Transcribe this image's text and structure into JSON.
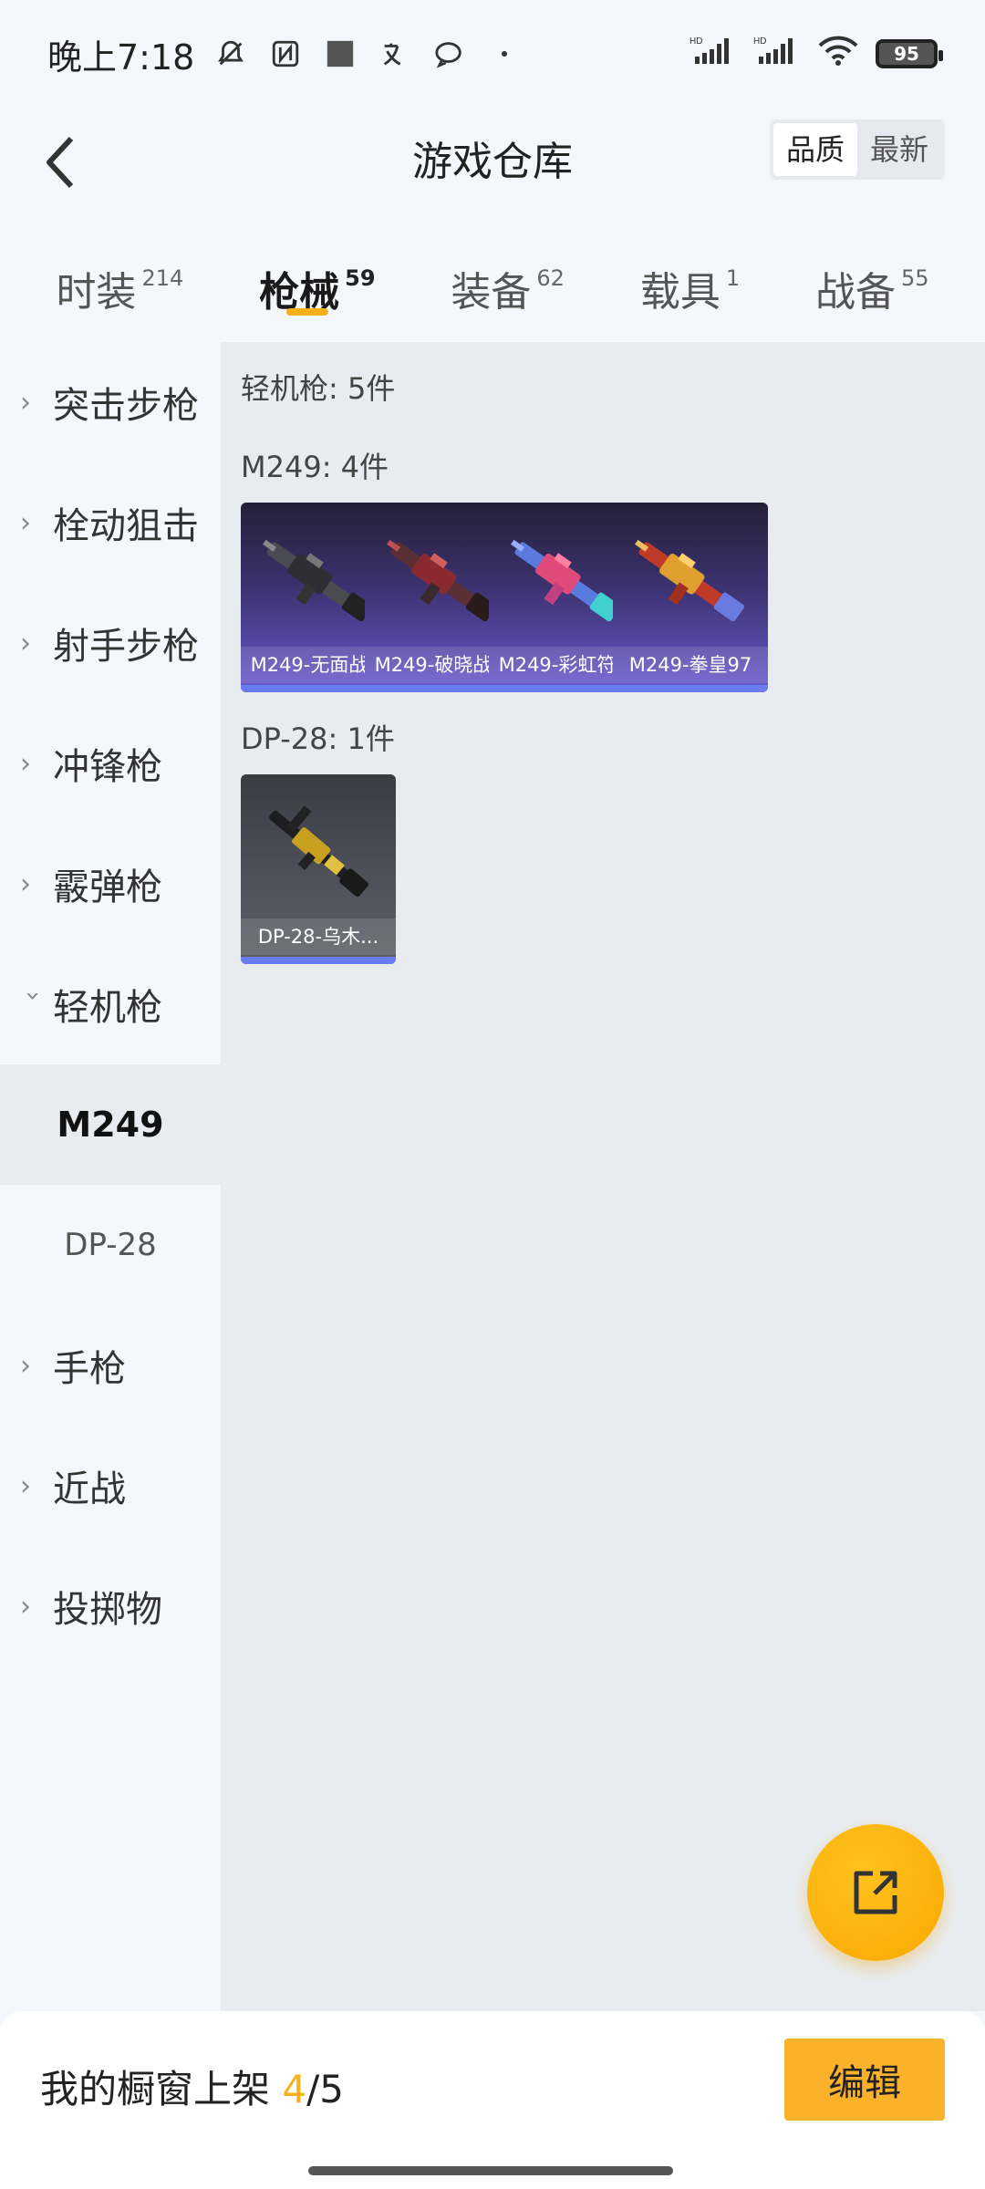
{
  "status_bar": {
    "time": "晚上7:18",
    "battery": "95",
    "icons": [
      "bell-muted-icon",
      "nfc-icon",
      "square-icon",
      "translate-icon",
      "chat-icon",
      "dot-icon",
      "signal-hd-icon",
      "signal-hd-icon",
      "wifi-icon",
      "battery-icon"
    ]
  },
  "header": {
    "title": "游戏仓库",
    "sort_options": [
      "品质",
      "最新"
    ],
    "active_sort": "品质"
  },
  "tabs": [
    {
      "label": "时装",
      "count": "214"
    },
    {
      "label": "枪械",
      "count": "59"
    },
    {
      "label": "装备",
      "count": "62"
    },
    {
      "label": "载具",
      "count": "1"
    },
    {
      "label": "战备",
      "count": "55"
    }
  ],
  "active_tab": "枪械",
  "sidebar": {
    "items": [
      {
        "label": "突击步枪",
        "expanded": false
      },
      {
        "label": "栓动狙击",
        "expanded": false
      },
      {
        "label": "射手步枪",
        "expanded": false
      },
      {
        "label": "冲锋枪",
        "expanded": false
      },
      {
        "label": "霰弹枪",
        "expanded": false
      },
      {
        "label": "轻机枪",
        "expanded": true
      },
      {
        "label": "手枪",
        "expanded": false
      },
      {
        "label": "近战",
        "expanded": false
      },
      {
        "label": "投掷物",
        "expanded": false
      }
    ],
    "sub_items": [
      "M249",
      "DP-28"
    ],
    "active_sub": "M249"
  },
  "content": {
    "category_summary": "轻机枪: 5件",
    "groups": [
      {
        "title": "M249: 4件",
        "items": [
          {
            "name": "M249-无面战...",
            "rarity_color": "#6a7cf0"
          },
          {
            "name": "M249-破晓战...",
            "rarity_color": "#6a7cf0"
          },
          {
            "name": "M249-彩虹符...",
            "rarity_color": "#6a7cf0"
          },
          {
            "name": "M249-拳皇97",
            "rarity_color": "#6a7cf0"
          }
        ]
      },
      {
        "title": "DP-28: 1件",
        "items": [
          {
            "name": "DP-28-乌木...",
            "rarity_color": "#6a7cf0"
          }
        ]
      }
    ]
  },
  "fab": {
    "icon": "share-external-icon"
  },
  "bottom_bar": {
    "label": "我的橱窗上架",
    "current": "4",
    "total": "/5",
    "edit_label": "编辑"
  },
  "colors": {
    "accent": "#f7b01a",
    "rarity_purple": "#6a7cf0",
    "content_bg": "#e8ecf0"
  }
}
